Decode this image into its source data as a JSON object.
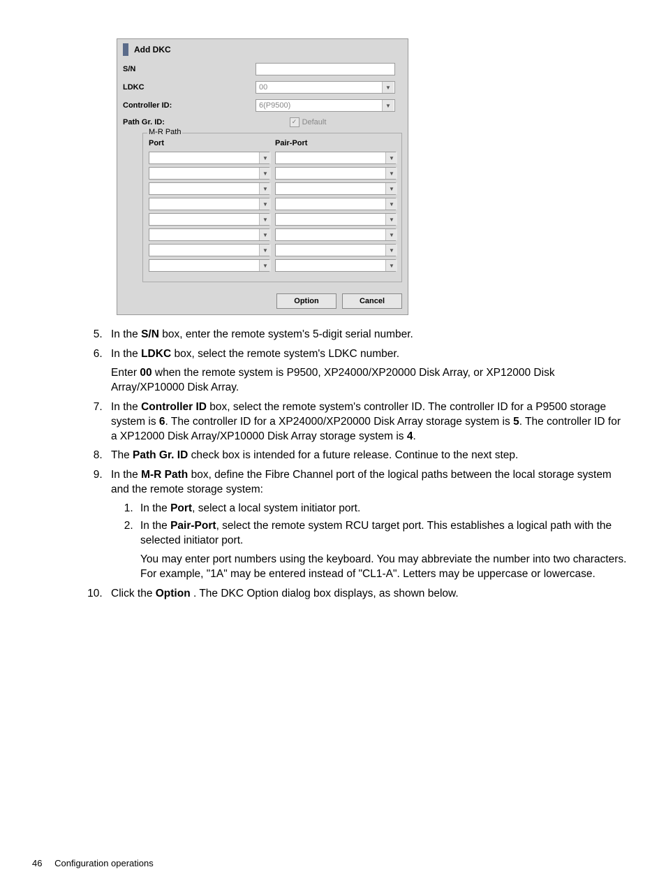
{
  "dialog": {
    "title": "Add DKC",
    "fields": {
      "sn_label": "S/N",
      "sn_value": "",
      "ldkc_label": "LDKC",
      "ldkc_value": "00",
      "controller_label": "Controller ID:",
      "controller_value": "6(P9500)",
      "pathgr_label": "Path Gr. ID:",
      "pathgr_default_label": "Default",
      "pathgr_checked": true
    },
    "mrpath": {
      "legend": "M-R Path",
      "port_header": "Port",
      "pairport_header": "Pair-Port",
      "row_count": 8
    },
    "buttons": {
      "option": "Option",
      "cancel": "Cancel"
    }
  },
  "instructions": {
    "start": 5,
    "items": [
      {
        "html": "In the <b>S/N</b> box, enter the remote system's 5-digit serial number."
      },
      {
        "html": "In the <b>LDKC</b> box, select the remote system's LDKC number.",
        "after": "Enter <b>00</b> when the remote system is P9500, XP24000/XP20000 Disk Array, or XP12000 Disk Array/XP10000 Disk Array."
      },
      {
        "html": "In the <b>Controller ID</b> box, select the remote system's controller ID. The controller ID for a P9500 storage system is <b>6</b>. The controller ID for a XP24000/XP20000 Disk Array storage system is <b>5</b>. The controller ID for a XP12000 Disk Array/XP10000 Disk Array storage system is <b>4</b>."
      },
      {
        "html": "The <b>Path Gr. ID</b> check box is intended for a future release. Continue to the next step."
      },
      {
        "html": "In the <b>M-R Path</b> box, define the Fibre Channel port of the logical paths between the local storage system and the remote storage system:",
        "sub": [
          "In the <b>Port</b>, select a local system initiator port.",
          "In the <b>Pair-Port</b>, select the remote system RCU target port. This establishes a logical path with the selected initiator port."
        ],
        "sub_after": "You may enter port numbers using the keyboard. You may abbreviate the number into two characters. For example, \"1A\" may be entered instead of \"CL1-A\". Letters may be uppercase or lowercase."
      },
      {
        "html": "Click the <b>Option</b> . The DKC Option dialog box displays, as shown below."
      }
    ]
  },
  "footer": {
    "page_number": "46",
    "section": "Configuration operations"
  }
}
